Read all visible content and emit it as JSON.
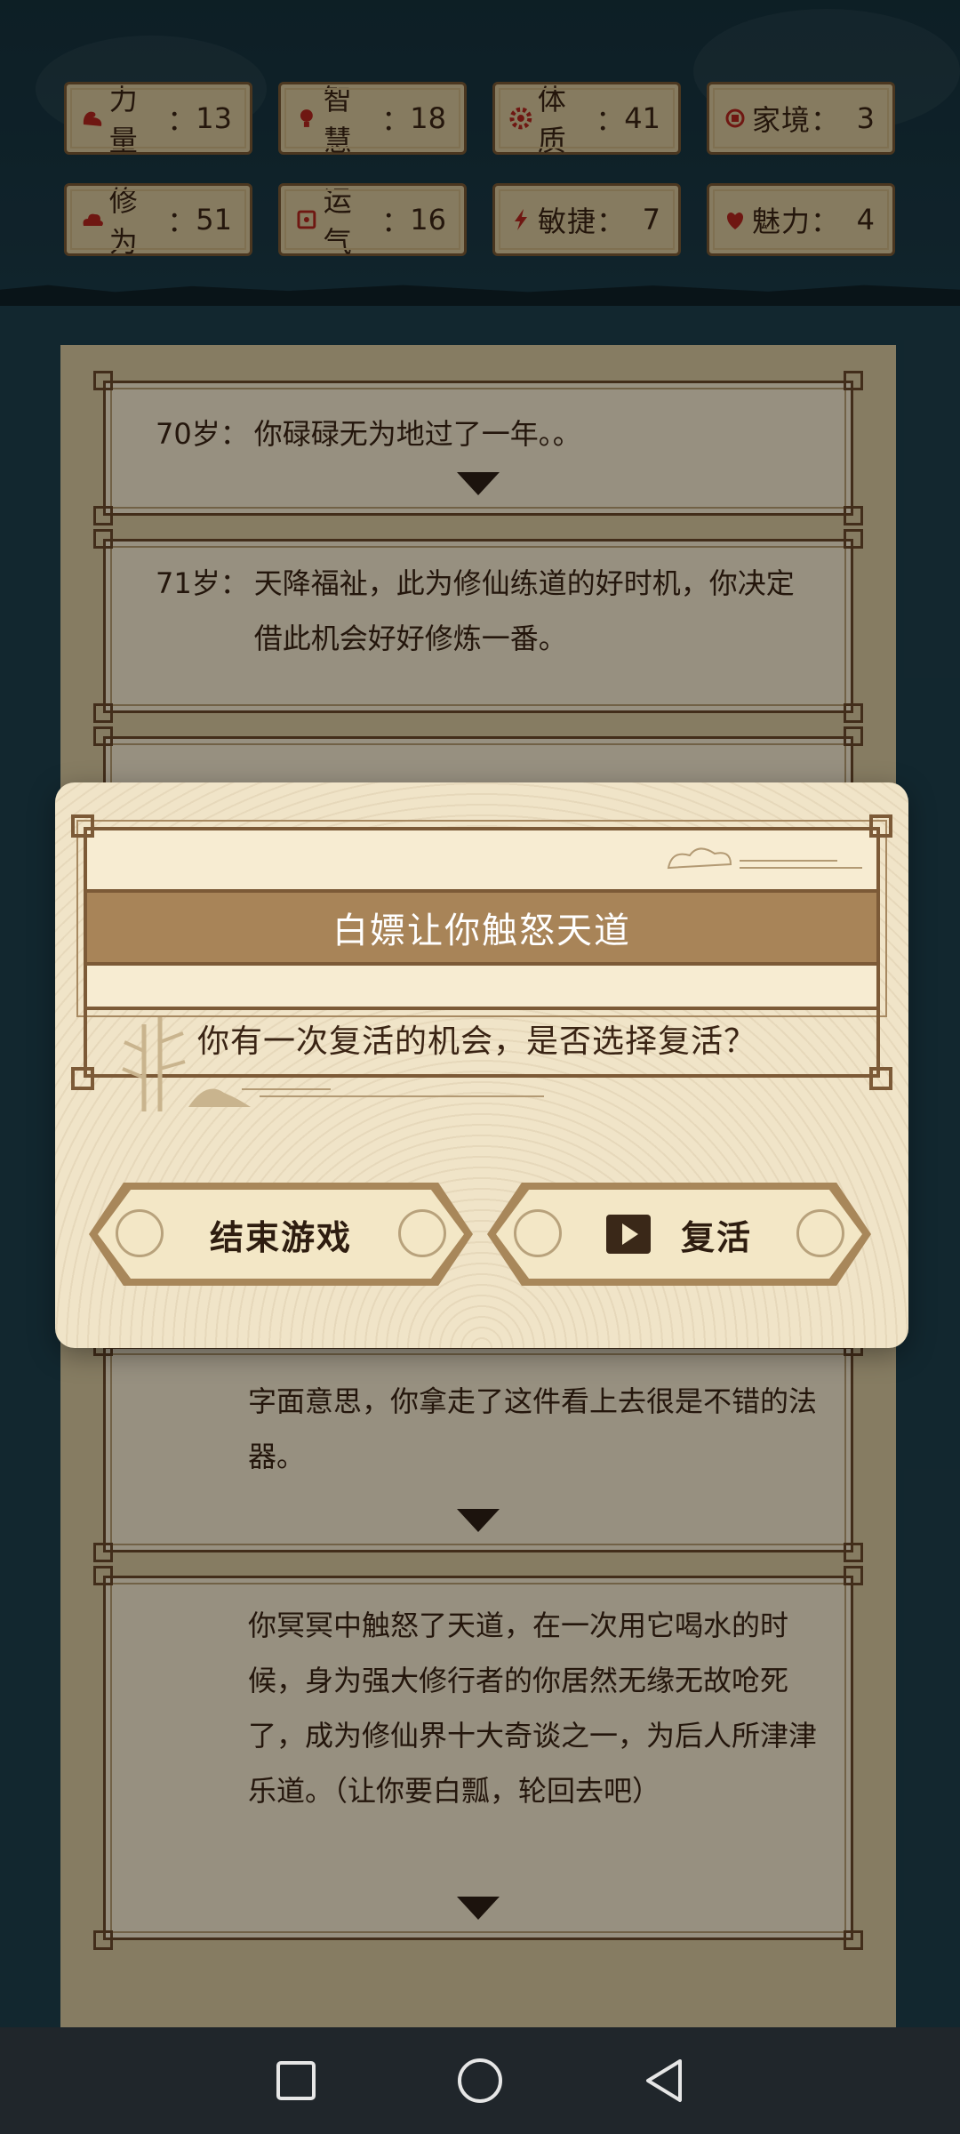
{
  "stats": [
    {
      "name": "力量",
      "value": "13",
      "icon": "muscle-icon",
      "color": "#b3261e"
    },
    {
      "name": "智慧",
      "value": "18",
      "icon": "lightbulb-icon",
      "color": "#b3261e"
    },
    {
      "name": "体质",
      "value": "41",
      "icon": "gear-icon",
      "color": "#b3261e"
    },
    {
      "name": "家境",
      "value": "3",
      "icon": "house-icon",
      "color": "#b3261e"
    },
    {
      "name": "修为",
      "value": "51",
      "icon": "cloud-icon",
      "color": "#b3261e"
    },
    {
      "name": "运气",
      "value": "16",
      "icon": "dice-icon",
      "color": "#b3261e"
    },
    {
      "name": "敏捷",
      "value": "7",
      "icon": "lightning-icon",
      "color": "#b3261e"
    },
    {
      "name": "魅力",
      "value": "4",
      "icon": "heart-icon",
      "color": "#b3261e"
    }
  ],
  "log": [
    {
      "age": "70岁：",
      "text": "你碌碌无为地过了一年。。"
    },
    {
      "age": "71岁：",
      "text": "天降福祉，此为修仙练道的好时机，你决定借此机会好好修炼一番。"
    },
    {
      "age": "",
      "text": "字面意思，你拿走了这件看上去很是不错的法器。"
    },
    {
      "age": "",
      "text": "你冥冥中触怒了天道，在一次用它喝水的时候，身为强大修行者的你居然无缘无故呛死了，成为修仙界十大奇谈之一，为后人所津津乐道。（让你要白瓢，轮回去吧）"
    }
  ],
  "modal": {
    "title": "白嫖让你触怒天道",
    "message": "你有一次复活的机会，是否选择复活？",
    "end_button": "结束游戏",
    "revive_button": "复活"
  },
  "colors": {
    "accent": "#a88458",
    "background": "#1e3f4c",
    "parchment": "#f4e9cf"
  }
}
